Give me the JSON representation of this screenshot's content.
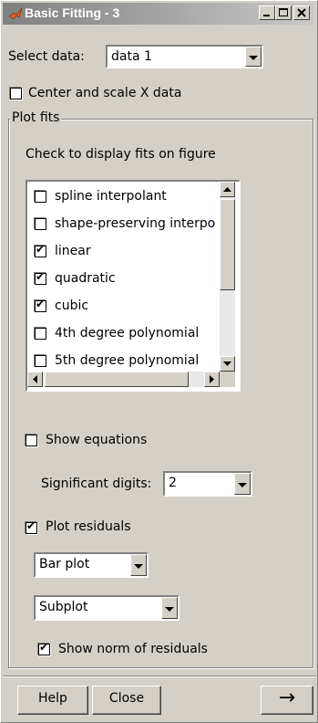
{
  "window": {
    "title": "Basic Fitting - 3"
  },
  "select_data": {
    "label": "Select data:",
    "value": "data 1"
  },
  "center_scale": {
    "label": "Center and scale X data",
    "checked": false
  },
  "plot_fits": {
    "group_label": "Plot fits",
    "instructions": "Check to display fits on figure",
    "fits": [
      {
        "label": "spline interpolant",
        "checked": false
      },
      {
        "label": "shape-preserving interpo",
        "checked": false
      },
      {
        "label": "linear",
        "checked": true
      },
      {
        "label": "quadratic",
        "checked": true
      },
      {
        "label": "cubic",
        "checked": true
      },
      {
        "label": "4th degree polynomial",
        "checked": false
      },
      {
        "label": "5th degree polynomial",
        "checked": false
      }
    ]
  },
  "show_equations": {
    "label": "Show equations",
    "checked": false
  },
  "significant_digits": {
    "label": "Significant digits:",
    "value": "2"
  },
  "plot_residuals": {
    "label": "Plot residuals",
    "checked": true,
    "plot_type": "Bar plot",
    "plot_location": "Subplot"
  },
  "show_norm": {
    "label": "Show norm of residuals",
    "checked": true
  },
  "buttons": {
    "help": "Help",
    "close": "Close",
    "more": "→"
  },
  "icons": {
    "title_icon": "matlab-logo-icon",
    "check_mark": "✔"
  }
}
